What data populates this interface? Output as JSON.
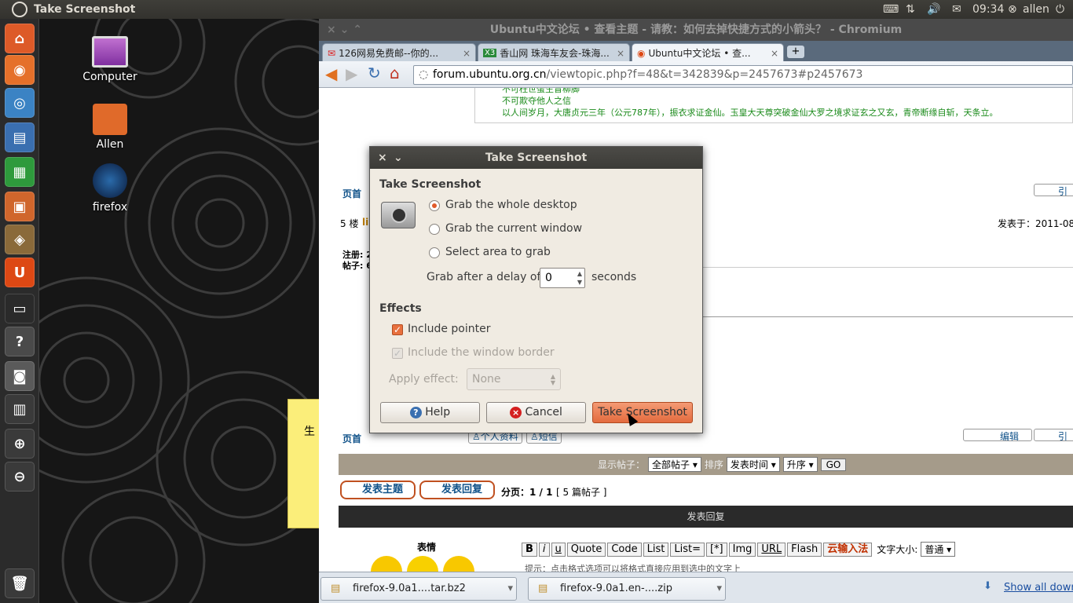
{
  "topbar": {
    "app_title": "Take Screenshot",
    "time": "09:34",
    "user": "allen"
  },
  "desktop": {
    "icons": [
      {
        "label": "Computer"
      },
      {
        "label": "Allen"
      },
      {
        "label": "firefox"
      }
    ],
    "sticky_text": "生"
  },
  "browser": {
    "window_title": "Ubuntu中文论坛 • 查看主题 - 请教：如何去掉快捷方式的小箭头？ - Chromium",
    "tabs": [
      {
        "label": "126网易免费邮--你的..."
      },
      {
        "label": "香山网 珠海车友会-珠海..."
      },
      {
        "label": "Ubuntu中文论坛 • 查..."
      }
    ],
    "url_host": "forum.ubuntu.org.cn",
    "url_path": "/viewtopic.php?f=48&t=342839&p=2457673#p2457673",
    "content": {
      "sig_line1": "不可枉世蛋生冒柳脚",
      "sig_line2": "不可欺夺他人之信",
      "sig_line3": "以人间岁月，大唐贞元三年（公元787年），振衣求证金仙。玉皇大天尊突破金仙大罗之境求证玄之又玄，青帝断缘自斩，天条立。",
      "top_link": "页首",
      "quote_btn": "引",
      "post_floor": "5 楼",
      "post_user": "li",
      "posted_label": "发表于：2011-08-",
      "reg_label": "注册: 2",
      "posts_label": "帖子: 6",
      "profile_btn": "个人资料",
      "pm_btn": "短信",
      "edit_btn": "编辑",
      "display_label": "显示帖子：",
      "display_select": "全部帖子",
      "sort_label": "排序",
      "sort_select": "发表时间",
      "order_select": "升序",
      "go_btn": "GO",
      "new_topic_btn": "发表主题",
      "reply_btn": "发表回复",
      "pagination": "分页：1 / 1",
      "post_count": "[ 5 篇帖子 ]",
      "reply_header": "发表回复",
      "smilies_label": "表情",
      "bbcode": [
        "B",
        "i",
        "u",
        "Quote",
        "Code",
        "List",
        "List=",
        "[*]",
        "Img",
        "URL",
        "Flash"
      ],
      "ime_btn": "云输入法",
      "font_size_label": "文字大小:",
      "font_size_select": "普通",
      "hint": "提示：点击格式选项可以将格式直接应用到选中的文字上"
    },
    "downloads": {
      "items": [
        {
          "name": "firefox-9.0a1....tar.bz2"
        },
        {
          "name": "firefox-9.0a1.en-....zip"
        }
      ],
      "show_all": "Show all down"
    }
  },
  "dialog": {
    "title": "Take Screenshot",
    "section1": "Take Screenshot",
    "radio_desktop": "Grab the whole desktop",
    "radio_window": "Grab the current window",
    "radio_area": "Select area to grab",
    "delay_label": "Grab after a delay of",
    "delay_value": "0",
    "delay_unit": "seconds",
    "section2": "Effects",
    "include_pointer": "Include pointer",
    "include_border": "Include the window border",
    "apply_effect_label": "Apply effect:",
    "apply_effect_value": "None",
    "help_btn": "Help",
    "cancel_btn": "Cancel",
    "take_btn": "Take Screenshot"
  }
}
